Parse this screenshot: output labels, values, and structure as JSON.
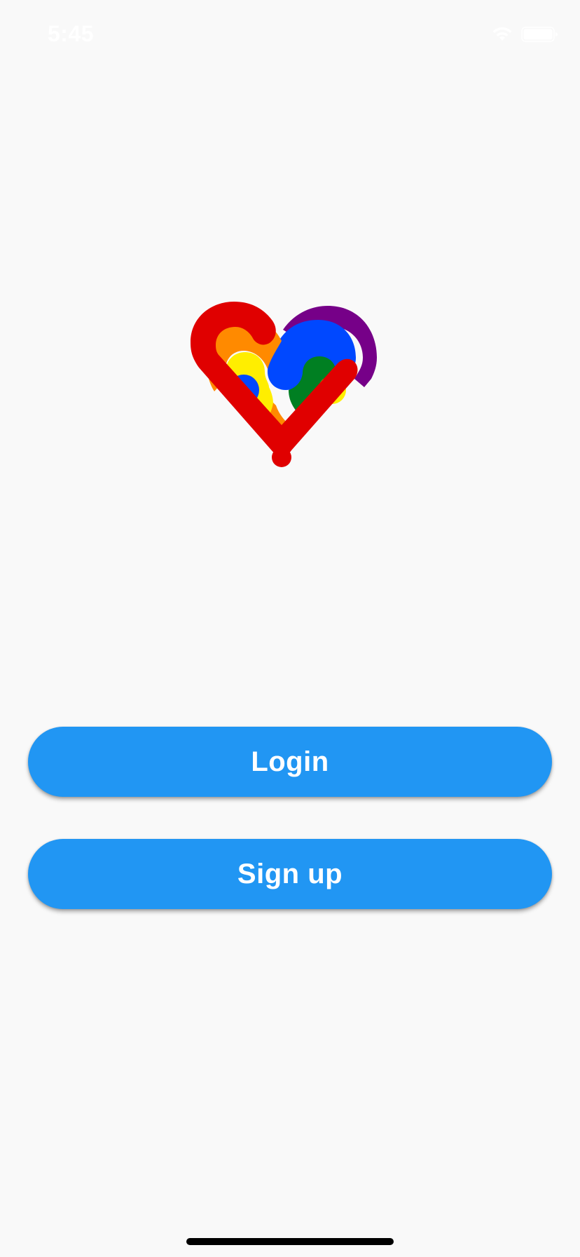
{
  "status_bar": {
    "time": "5:45",
    "wifi_icon": "wifi-icon",
    "battery_icon": "battery-icon"
  },
  "logo": {
    "icon": "rainbow-heart-logo",
    "colors": [
      "#e00000",
      "#ff8a00",
      "#ffee00",
      "#007f22",
      "#0048ff",
      "#760088"
    ]
  },
  "actions": {
    "login_label": "Login",
    "signup_label": "Sign up"
  },
  "theme": {
    "background": "#f9f9f9",
    "primary": "#2196f3",
    "button_text": "#ffffff"
  }
}
